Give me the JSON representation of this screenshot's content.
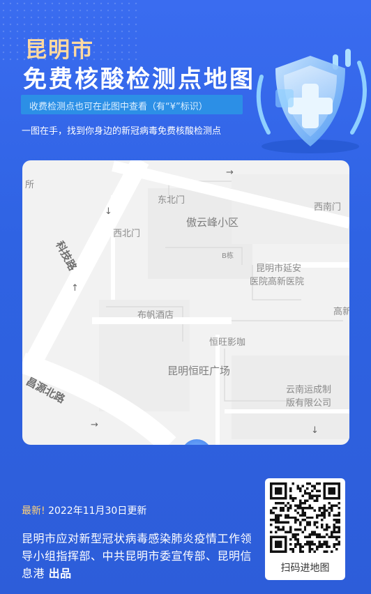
{
  "header": {
    "city": "昆明市",
    "title": "免费核酸检测点地图",
    "subtitle": "收费检测点也可在此图中查看（有“¥”标识）",
    "tagline": "一图在手，找到你身边的新冠病毒免费核酸检测点"
  },
  "map": {
    "labels": {
      "fragment_left": "所",
      "dongbeimen": "东北门",
      "xinanmen": "西南门",
      "aoyunfeng": "傲云峰小区",
      "xibeimen": "西北门",
      "b_building": "B栋",
      "yanan_1": "昆明市延安",
      "yanan_2": "医院高新医院",
      "gaoxin": "高新",
      "bufan": "布帆酒店",
      "hengwang_cafe": "恒旺影咖",
      "hengwang_plaza": "昆明恒旺广场",
      "yunnan_1": "云南运成制",
      "yunnan_2": "版有限公司"
    },
    "roads": {
      "keji": "科技路",
      "changyuan": "昌源北路"
    },
    "arrows": [
      "↓",
      "↑",
      "→",
      "→",
      "↓"
    ]
  },
  "footer": {
    "latest_label": "最新!",
    "update_text": "2022年11月30日更新",
    "publisher_text": "昆明市应对新型冠状病毒感染肺炎疫情工作领导小组指挥部、中共昆明市委宣传部、昆明信息港",
    "publisher_suffix": "出品",
    "qr_caption": "扫码进地图"
  },
  "colors": {
    "background": "#2f63e3",
    "city_title": "#ffd9a0",
    "subtitle_box": "#2c8fe6",
    "map_background": "#f2f2f2"
  }
}
